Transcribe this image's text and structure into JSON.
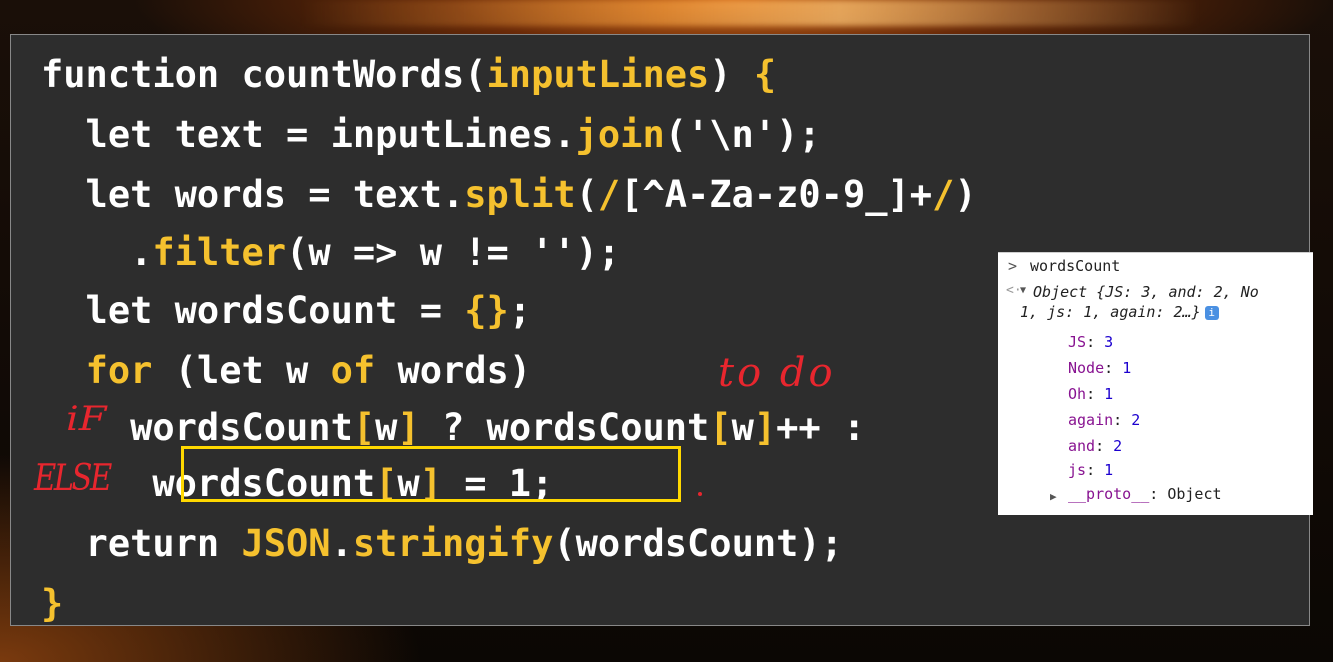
{
  "code_lines": [
    [
      {
        "t": "function countWords(",
        "c": "p"
      },
      {
        "t": "inputLines",
        "c": "hl"
      },
      {
        "t": ") ",
        "c": "p"
      },
      {
        "t": "{",
        "c": "hl"
      }
    ],
    [
      {
        "t": "  let text = inputLines.",
        "c": "p"
      },
      {
        "t": "join",
        "c": "hl"
      },
      {
        "t": "('\\n');",
        "c": "p"
      }
    ],
    [
      {
        "t": "  let words = text.",
        "c": "p"
      },
      {
        "t": "split",
        "c": "hl"
      },
      {
        "t": "(",
        "c": "p"
      },
      {
        "t": "/",
        "c": "hl"
      },
      {
        "t": "[^A-Za-z0-9_]+",
        "c": "p"
      },
      {
        "t": "/",
        "c": "hl"
      },
      {
        "t": ")",
        "c": "p"
      }
    ],
    [
      {
        "t": "    .",
        "c": "p"
      },
      {
        "t": "filter",
        "c": "hl"
      },
      {
        "t": "(w => w != '');",
        "c": "p"
      }
    ],
    [
      {
        "t": "  let wordsCount = ",
        "c": "p"
      },
      {
        "t": "{}",
        "c": "hl"
      },
      {
        "t": ";",
        "c": "p"
      }
    ],
    [
      {
        "t": "  ",
        "c": "p"
      },
      {
        "t": "for",
        "c": "hl"
      },
      {
        "t": " (let w ",
        "c": "p"
      },
      {
        "t": "of",
        "c": "hl"
      },
      {
        "t": " words)",
        "c": "p"
      }
    ],
    [
      {
        "t": "    wordsCount",
        "c": "p"
      },
      {
        "t": "[",
        "c": "hl"
      },
      {
        "t": "w",
        "c": "p"
      },
      {
        "t": "]",
        "c": "hl"
      },
      {
        "t": " ? wordsCount",
        "c": "p"
      },
      {
        "t": "[",
        "c": "hl"
      },
      {
        "t": "w",
        "c": "p"
      },
      {
        "t": "]",
        "c": "hl"
      },
      {
        "t": "++ :",
        "c": "p"
      }
    ],
    [
      {
        "t": "     wordsCount",
        "c": "p"
      },
      {
        "t": "[",
        "c": "hl"
      },
      {
        "t": "w",
        "c": "p"
      },
      {
        "t": "]",
        "c": "hl"
      },
      {
        "t": " = 1;",
        "c": "p"
      }
    ],
    [
      {
        "t": "  return ",
        "c": "p"
      },
      {
        "t": "JSON",
        "c": "hl"
      },
      {
        "t": ".",
        "c": "p"
      },
      {
        "t": "stringify",
        "c": "hl"
      },
      {
        "t": "(wordsCount);",
        "c": "p"
      }
    ],
    [
      {
        "t": "}",
        "c": "hl"
      }
    ]
  ],
  "annotations": {
    "if": "iF",
    "else": "ELSE",
    "todo": "to do"
  },
  "console": {
    "prompt": ">",
    "command": "wordsCount",
    "return_marker": "<·",
    "object_line1": "Object {JS: 3, and: 2, No",
    "object_line2": "1, js: 1, again: 2…}",
    "info_icon": "i",
    "properties": [
      {
        "key": "JS",
        "value": "3"
      },
      {
        "key": "Node",
        "value": "1"
      },
      {
        "key": "Oh",
        "value": "1"
      },
      {
        "key": "again",
        "value": "2"
      },
      {
        "key": "and",
        "value": "2"
      },
      {
        "key": "js",
        "value": "1"
      }
    ],
    "proto_label": "__proto__",
    "proto_value": ": Object"
  },
  "colors": {
    "highlight": "#f5c12e",
    "code_text": "#ffffff",
    "panel_bg": "#2d2d2d",
    "box_outline": "#ffd800",
    "handwriting": "#e8262e"
  }
}
